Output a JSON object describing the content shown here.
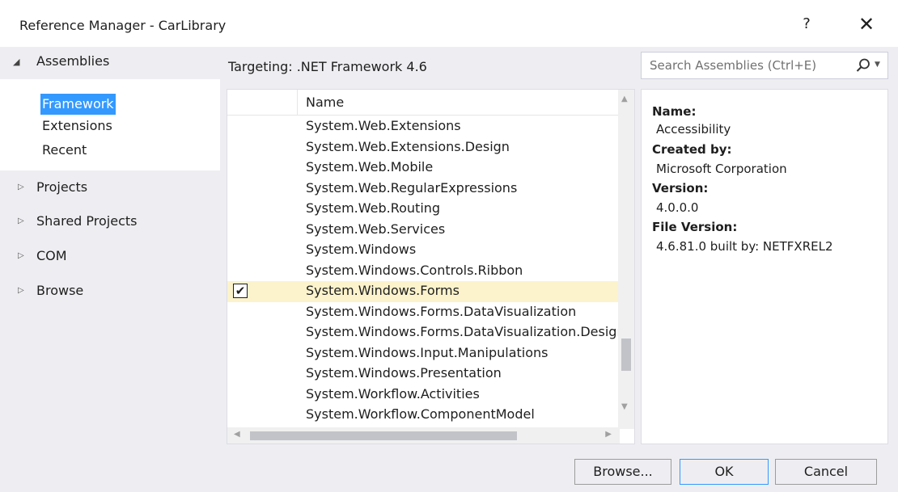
{
  "window": {
    "title": "Reference Manager - CarLibrary",
    "help_glyph": "?",
    "close_glyph": "✕"
  },
  "nav": {
    "assemblies": {
      "label": "Assemblies",
      "expanded": true
    },
    "sub_items": [
      {
        "label": "Framework",
        "selected": true
      },
      {
        "label": "Extensions",
        "selected": false
      },
      {
        "label": "Recent",
        "selected": false
      }
    ],
    "items": [
      {
        "label": "Projects"
      },
      {
        "label": "Shared Projects"
      },
      {
        "label": "COM"
      },
      {
        "label": "Browse"
      }
    ]
  },
  "targeting": "Targeting: .NET Framework 4.6",
  "search": {
    "placeholder": "Search Assemblies (Ctrl+E)",
    "value": ""
  },
  "list": {
    "column_name": "Name",
    "rows": [
      {
        "name": "System.Web.Extensions",
        "checked": false
      },
      {
        "name": "System.Web.Extensions.Design",
        "checked": false
      },
      {
        "name": "System.Web.Mobile",
        "checked": false
      },
      {
        "name": "System.Web.RegularExpressions",
        "checked": false
      },
      {
        "name": "System.Web.Routing",
        "checked": false
      },
      {
        "name": "System.Web.Services",
        "checked": false
      },
      {
        "name": "System.Windows",
        "checked": false
      },
      {
        "name": "System.Windows.Controls.Ribbon",
        "checked": false
      },
      {
        "name": "System.Windows.Forms",
        "checked": true
      },
      {
        "name": "System.Windows.Forms.DataVisualization",
        "checked": false
      },
      {
        "name": "System.Windows.Forms.DataVisualization.Design",
        "checked": false
      },
      {
        "name": "System.Windows.Input.Manipulations",
        "checked": false
      },
      {
        "name": "System.Windows.Presentation",
        "checked": false
      },
      {
        "name": "System.Workflow.Activities",
        "checked": false
      },
      {
        "name": "System.Workflow.ComponentModel",
        "checked": false
      }
    ],
    "selected_row": "System.Windows.Forms"
  },
  "details": {
    "name_label": "Name:",
    "name_value": "Accessibility",
    "created_by_label": "Created by:",
    "created_by_value": "Microsoft Corporation",
    "version_label": "Version:",
    "version_value": "4.0.0.0",
    "file_version_label": "File Version:",
    "file_version_value": "4.6.81.0 built by: NETFXREL2"
  },
  "buttons": {
    "browse": "Browse...",
    "ok": "OK",
    "cancel": "Cancel"
  },
  "colors": {
    "selection_blue": "#3399ff",
    "row_highlight": "#fcf3cc",
    "chrome_background": "#eeeef2"
  }
}
